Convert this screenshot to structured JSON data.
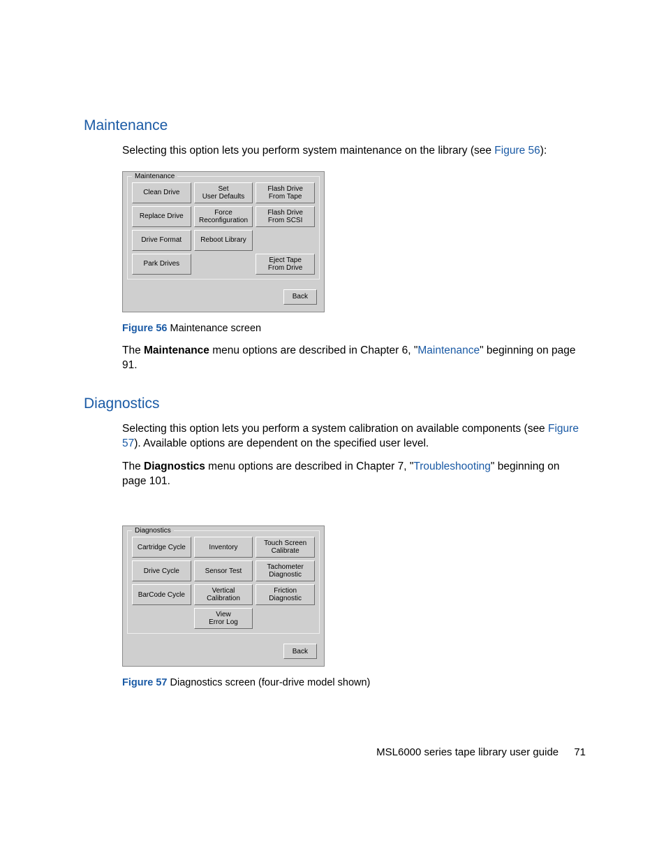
{
  "section1": {
    "heading": "Maintenance",
    "intro_pre": "Selecting this option lets you perform system maintenance on the library (see ",
    "intro_link": "Figure 56",
    "intro_post": "):",
    "panel_label": "Maintenance",
    "buttons": [
      [
        "Clean Drive",
        "Set\nUser Defaults",
        "Flash Drive\nFrom Tape"
      ],
      [
        "Replace Drive",
        "Force\nReconfiguration",
        "Flash Drive\nFrom SCSI"
      ],
      [
        "Drive Format",
        "Reboot Library",
        ""
      ],
      [
        "Park Drives",
        "",
        "Eject Tape\nFrom Drive"
      ]
    ],
    "back_label": "Back",
    "fig_num": "Figure 56",
    "fig_caption": " Maintenance screen",
    "para2_a": "The ",
    "para2_bold": "Maintenance",
    "para2_b": " menu options are described in Chapter 6, \"",
    "para2_link": "Maintenance",
    "para2_c": "\" beginning on page 91."
  },
  "section2": {
    "heading": "Diagnostics",
    "intro_pre": "Selecting this option lets you perform a system calibration on available components (see ",
    "intro_link": "Figure 57",
    "intro_post": "). Available options are dependent on the specified user level.",
    "para2_a": "The ",
    "para2_bold": "Diagnostics",
    "para2_b": " menu options are described in Chapter 7, \"",
    "para2_link": "Troubleshooting",
    "para2_c": "\" beginning on page 101.",
    "panel_label": "Diagnostics",
    "buttons": [
      [
        "Cartridge Cycle",
        "Inventory",
        "Touch Screen\nCalibrate"
      ],
      [
        "Drive Cycle",
        "Sensor Test",
        "Tachometer\nDiagnostic"
      ],
      [
        "BarCode Cycle",
        "Vertical\nCalibration",
        "Friction\nDiagnostic"
      ],
      [
        "",
        "View\nError Log",
        ""
      ]
    ],
    "back_label": "Back",
    "fig_num": "Figure 57",
    "fig_caption": " Diagnostics screen (four-drive model shown)"
  },
  "footer": {
    "title": "MSL6000 series tape library user guide",
    "page": "71"
  }
}
